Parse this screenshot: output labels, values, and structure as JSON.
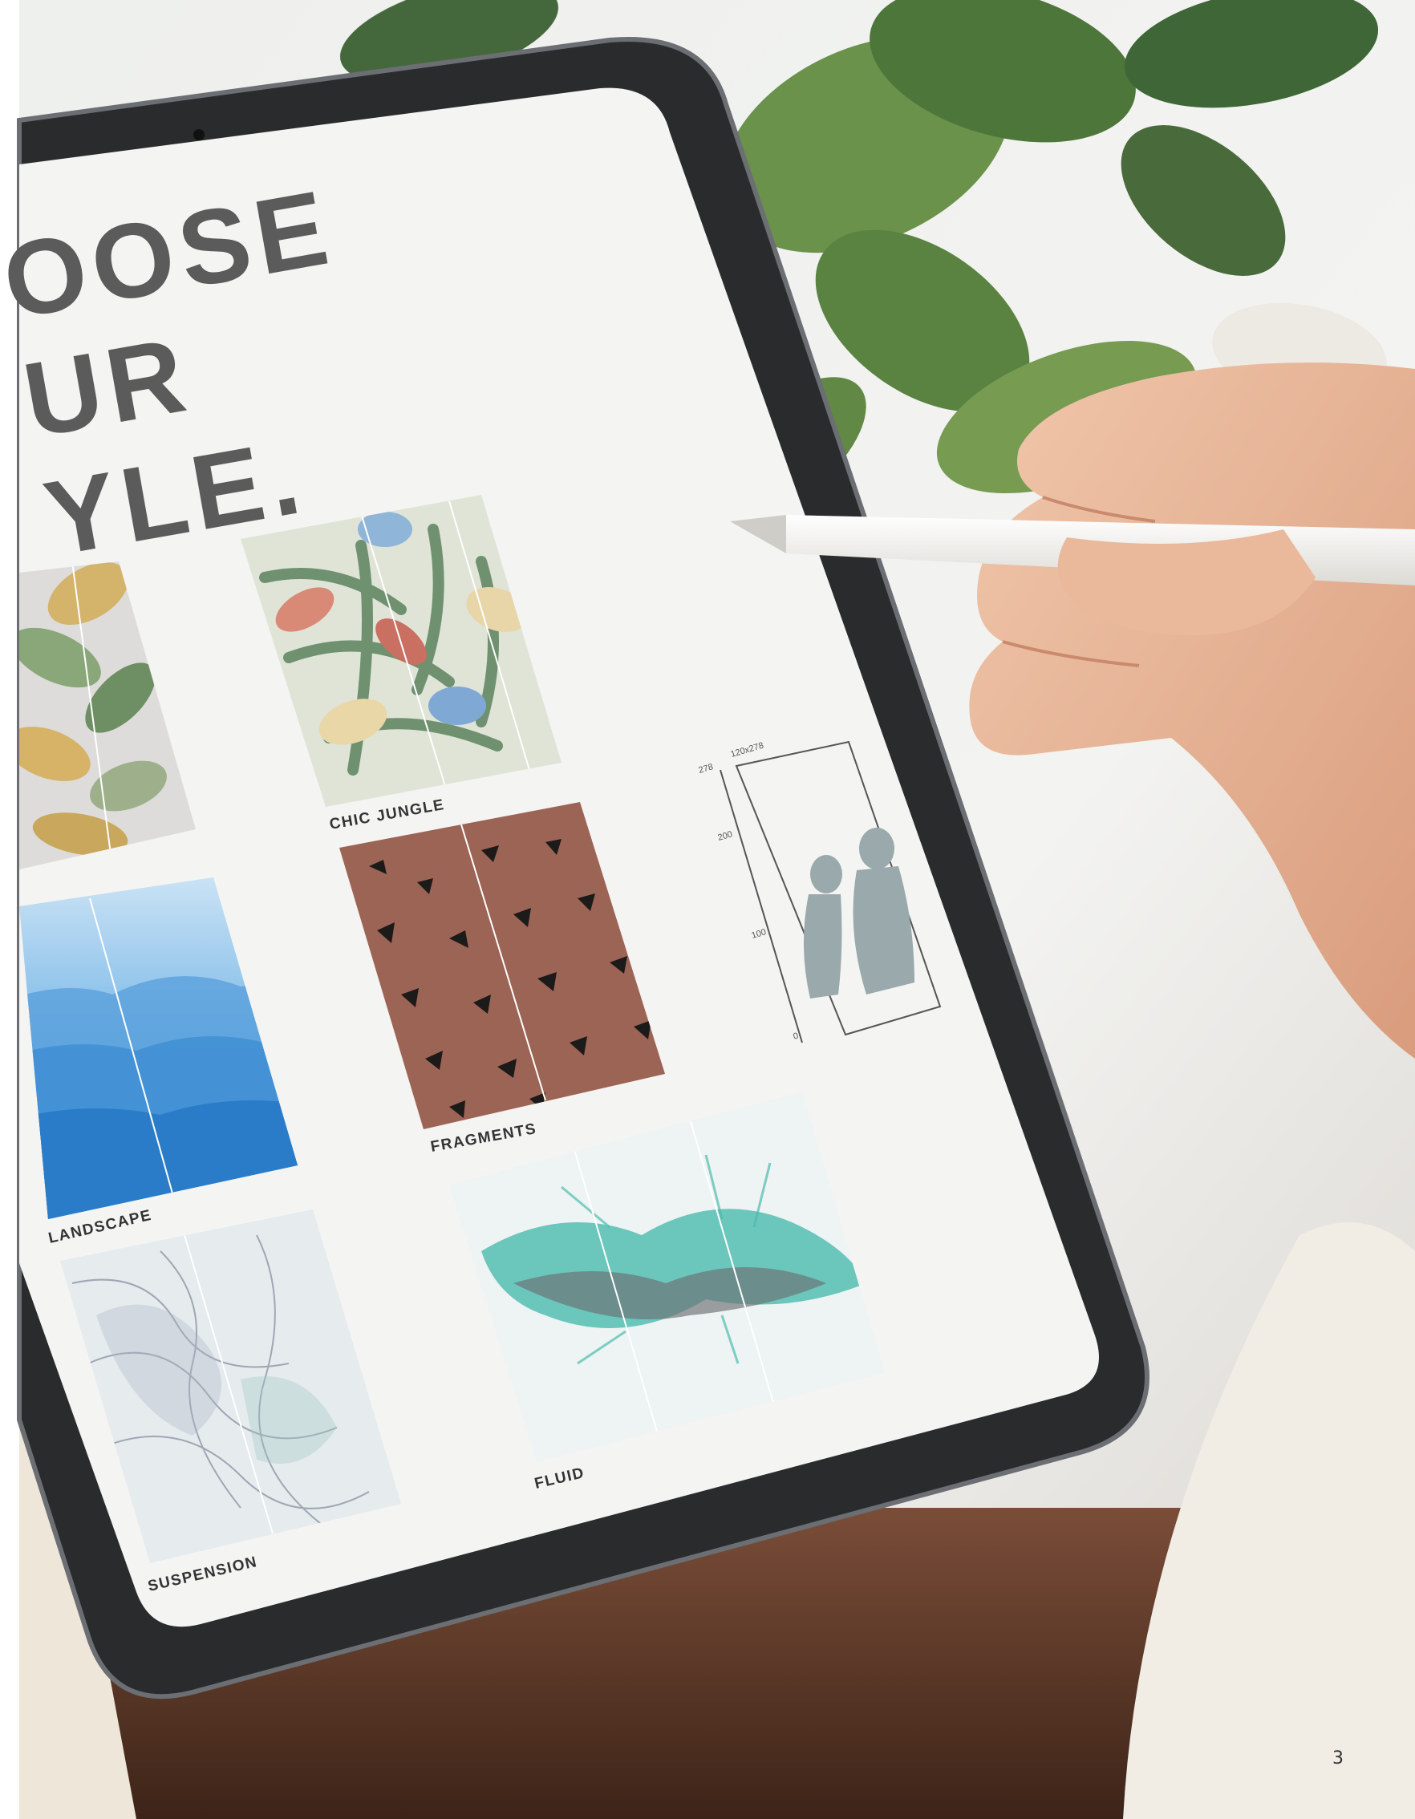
{
  "headline": {
    "lines": [
      "OOSE",
      "UR",
      "YLE."
    ]
  },
  "patterns": [
    {
      "id": "ginkgo",
      "label": ""
    },
    {
      "id": "chic-jungle",
      "label": "CHIC JUNGLE"
    },
    {
      "id": "landscape",
      "label": "LANDSCAPE"
    },
    {
      "id": "fragments",
      "label": "FRAGMENTS"
    },
    {
      "id": "suspension",
      "label": "SUSPENSION"
    },
    {
      "id": "fluid",
      "label": "FLUID"
    }
  ],
  "size_diagram": {
    "format": "120x278",
    "scale_marks": [
      "278",
      "200",
      "100",
      "0"
    ]
  },
  "page_number": "3",
  "colors": {
    "headline": "#5b5b5b",
    "tablet_bezel": "#1d1e20",
    "screen": "#f4f4f3",
    "fragments_base": "#9c6454",
    "landscape_sky": "#6aaee0",
    "jungle_leaf": "#7f9b7c",
    "silhouette": "#9aa9ab",
    "pencil": "#f4f3ef",
    "skin": "#e7b598"
  }
}
